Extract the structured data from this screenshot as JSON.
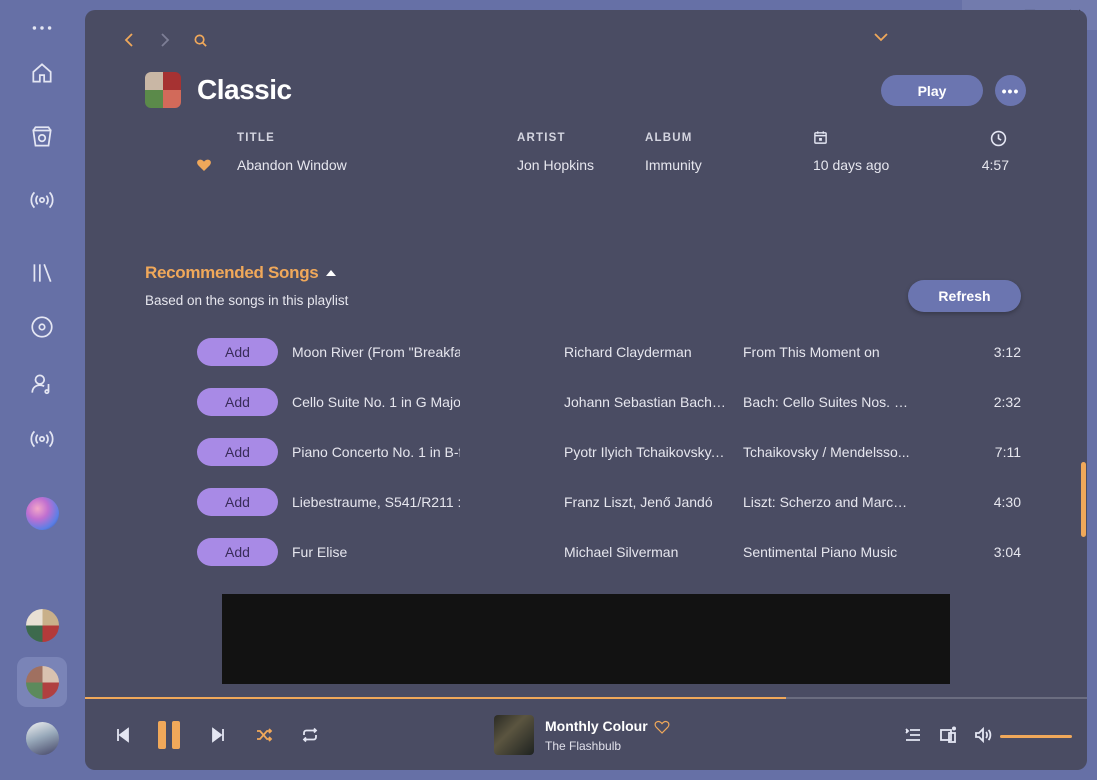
{
  "window": {
    "title": "Classic"
  },
  "colors": {
    "accent": "#f0a85a",
    "button_bg": "#6b75b0",
    "add_button_bg": "#a88ae6",
    "panel_bg": "#4a4c63",
    "frame_bg": "#6670a6"
  },
  "sidebar": {
    "icons": [
      "more-icon",
      "home-icon",
      "explore-icon",
      "radio-icon",
      "library-icon",
      "disc-icon",
      "artist-icon",
      "podcast-icon"
    ]
  },
  "playlist": {
    "title": "Classic",
    "play_label": "Play",
    "more_label": "•••",
    "columns": {
      "title": "TITLE",
      "artist": "ARTIST",
      "album": "ALBUM"
    },
    "tracks": [
      {
        "liked": true,
        "title": "Abandon Window",
        "artist": "Jon Hopkins",
        "album": "Immunity",
        "added": "10 days ago",
        "duration": "4:57"
      }
    ]
  },
  "recommended": {
    "title": "Recommended Songs",
    "subtitle": "Based on the songs in this playlist",
    "refresh_label": "Refresh",
    "add_label": "Add",
    "songs": [
      {
        "title": "Moon River (From \"Breakfa",
        "artist": "Richard Clayderman",
        "album": "From This Moment on",
        "duration": "3:12"
      },
      {
        "title": "Cello Suite No. 1 in G Majoı",
        "artist": "Johann Sebastian Bach, ...",
        "album": "Bach: Cello Suites Nos. 1,...",
        "duration": "2:32"
      },
      {
        "title": "Piano Concerto No. 1 in B-f",
        "artist": "Pyotr Ilyich Tchaikovsky, ...",
        "album": "Tchaikovsky / Mendelsso...",
        "duration": "7:11"
      },
      {
        "title": "Liebestraume, S541/R211 :",
        "artist": "Franz Liszt, Jenő Jandó",
        "album": "Liszt: Scherzo and March...",
        "duration": "4:30"
      },
      {
        "title": "Fur Elise",
        "artist": "Michael Silverman",
        "album": "Sentimental Piano Music",
        "duration": "3:04"
      }
    ]
  },
  "player": {
    "now_playing_title": "Monthly Colour",
    "now_playing_artist": "The Flashbulb",
    "progress": 0.7,
    "volume": 1.0,
    "state": "playing"
  }
}
